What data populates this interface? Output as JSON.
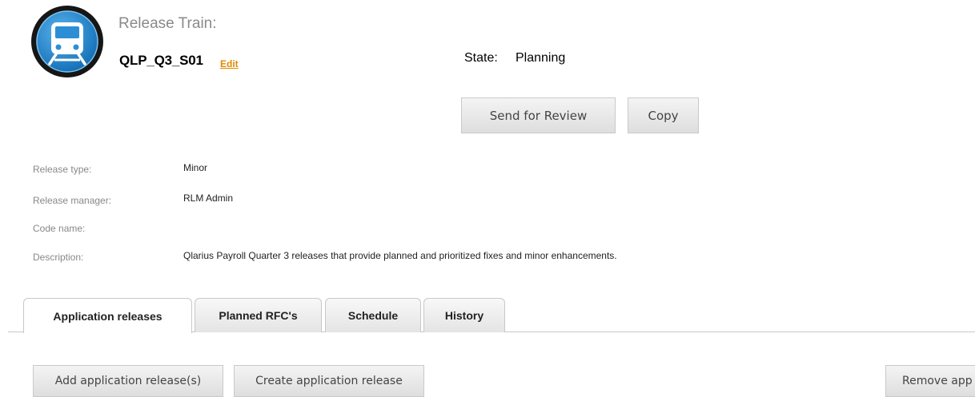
{
  "header": {
    "title": "Release Train:",
    "name": "QLP_Q3_S01",
    "edit_label": "Edit",
    "state_label": "State:",
    "state_value": "Planning"
  },
  "actions": {
    "send_for_review": "Send for Review",
    "copy": "Copy"
  },
  "details": [
    {
      "label": "Release type:",
      "value": "Minor"
    },
    {
      "label": "Release manager:",
      "value": "RLM Admin"
    },
    {
      "label": "Code name:",
      "value": ""
    },
    {
      "label": "Description:",
      "value": "Qlarius Payroll Quarter 3 releases that provide planned and prioritized fixes and minor enhancements."
    }
  ],
  "tabs": [
    {
      "label": "Application releases",
      "active": true
    },
    {
      "label": "Planned RFC's",
      "active": false
    },
    {
      "label": "Schedule",
      "active": false
    },
    {
      "label": "History",
      "active": false
    }
  ],
  "tab_actions": {
    "add": "Add application release(s)",
    "create": "Create application release",
    "remove": "Remove app"
  },
  "colors": {
    "edit_link": "#e08a00",
    "logo_ring": "#1a1a1a",
    "logo_fill": "#2c8fd6"
  },
  "icons": {
    "logo": "train-icon"
  }
}
